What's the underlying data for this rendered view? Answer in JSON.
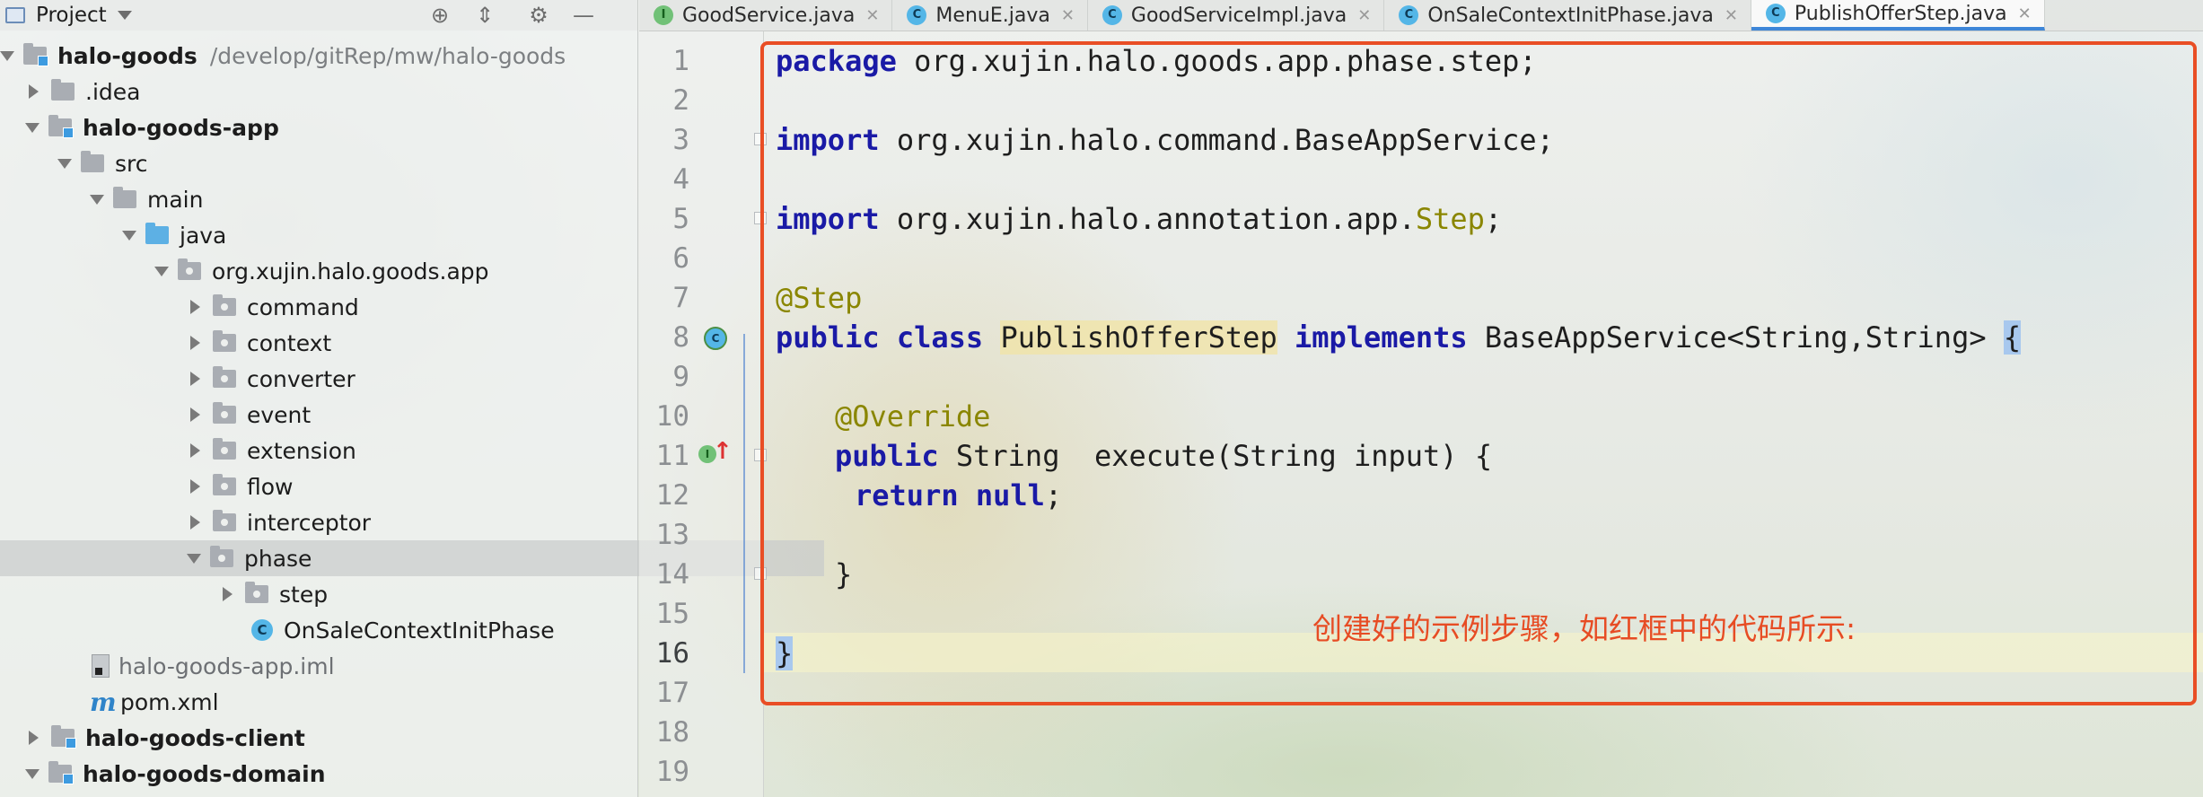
{
  "project_panel": {
    "title": "Project",
    "tree": [
      {
        "label": "halo-goods",
        "path": "/develop/gitRep/mw/halo-goods"
      },
      {
        "label": ".idea"
      },
      {
        "label": "halo-goods-app"
      },
      {
        "label": "src"
      },
      {
        "label": "main"
      },
      {
        "label": "java"
      },
      {
        "label": "org.xujin.halo.goods.app"
      },
      {
        "label": "command"
      },
      {
        "label": "context"
      },
      {
        "label": "converter"
      },
      {
        "label": "event"
      },
      {
        "label": "extension"
      },
      {
        "label": "flow"
      },
      {
        "label": "interceptor"
      },
      {
        "label": "phase"
      },
      {
        "label": "step"
      },
      {
        "label": "OnSaleContextInitPhase"
      },
      {
        "label": "halo-goods-app.iml"
      },
      {
        "label": "pom.xml"
      },
      {
        "label": "halo-goods-client"
      },
      {
        "label": "halo-goods-domain"
      }
    ]
  },
  "tabs": [
    {
      "label": "GoodService.java",
      "icon": "I"
    },
    {
      "label": "MenuE.java",
      "icon": "C"
    },
    {
      "label": "GoodServiceImpl.java",
      "icon": "C"
    },
    {
      "label": "OnSaleContextInitPhase.java",
      "icon": "C"
    },
    {
      "label": "PublishOfferStep.java",
      "icon": "C"
    }
  ],
  "editor": {
    "line_numbers": [
      "1",
      "2",
      "3",
      "4",
      "5",
      "6",
      "7",
      "8",
      "9",
      "10",
      "11",
      "12",
      "13",
      "14",
      "15",
      "16",
      "17",
      "18",
      "19"
    ],
    "code": {
      "l1_kw": "package",
      "l1_rest": " org.xujin.halo.goods.app.phase.step;",
      "l3_kw": "import",
      "l3_rest": " org.xujin.halo.command.BaseAppService;",
      "l5_kw": "import",
      "l5_rest": " org.xujin.halo.annotation.app.",
      "l5_ann": "Step",
      "l5_end": ";",
      "l7_ann": "@Step",
      "l8_kw1": "public class",
      "l8_cls": "PublishOfferStep",
      "l8_kw2": "implements",
      "l8_rest": " BaseAppService<String,String> ",
      "l8_brace": "{",
      "l10_ann": "@Override",
      "l11_kw": "public",
      "l11_rest": " String  execute(String input) {",
      "l12_kw1": "return",
      "l12_kw2": "null",
      "l12_end": ";",
      "l14": "}",
      "l16": "}"
    }
  },
  "annotation_text": "创建好的示例步骤，如红框中的代码所示:",
  "colors": {
    "annotation": "#e74c24",
    "keyword": "#1a1aa6",
    "annotation_code": "#8a8600"
  }
}
